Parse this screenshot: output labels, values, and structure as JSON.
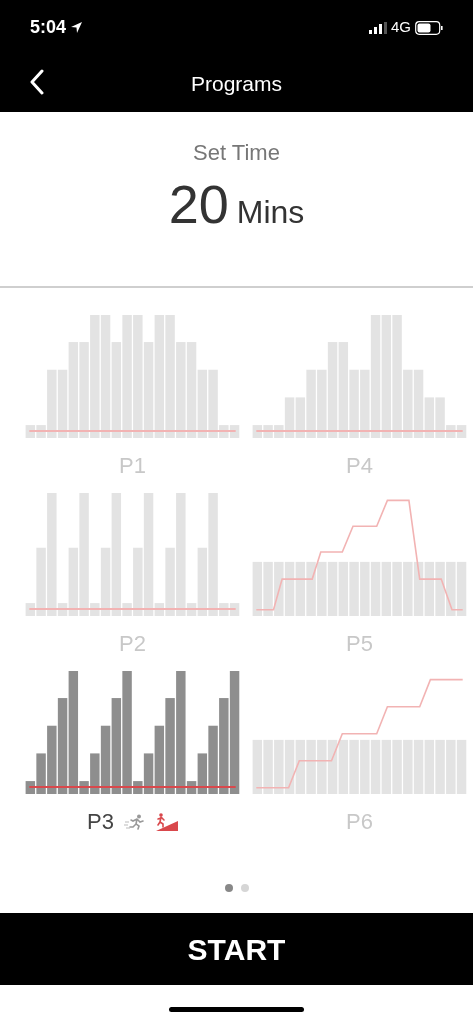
{
  "status_bar": {
    "time": "5:04",
    "network": "4G"
  },
  "header": {
    "title": "Programs"
  },
  "set_time": {
    "label": "Set Time",
    "value": "20",
    "unit": "Mins"
  },
  "programs": [
    {
      "label": "P1",
      "kind": "bars",
      "selected": false
    },
    {
      "label": "P4",
      "kind": "bars",
      "selected": false
    },
    {
      "label": "P2",
      "kind": "bars",
      "selected": false
    },
    {
      "label": "P5",
      "kind": "steps",
      "selected": false
    },
    {
      "label": "P3",
      "kind": "bars",
      "selected": true
    },
    {
      "label": "P6",
      "kind": "steps",
      "selected": false
    }
  ],
  "pager": [
    {
      "selected": true
    },
    {
      "selected": false
    }
  ],
  "start_button": {
    "label": "START"
  }
}
